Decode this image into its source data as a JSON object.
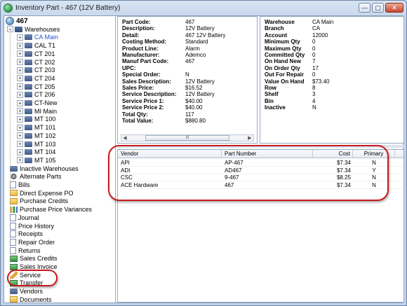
{
  "window": {
    "title": "Inventory Part - 467 (12V Battery)",
    "buttons": [
      "—",
      "▢",
      "✕"
    ]
  },
  "tree": {
    "root": "467",
    "warehouses_label": "Warehouses",
    "warehouses": [
      "CA Main",
      "CAL T1",
      "CT 201",
      "CT 202",
      "CT 203",
      "CT 204",
      "CT 205",
      "CT 206",
      "CT-New",
      "MI Main",
      "MT 100",
      "MT 101",
      "MT 102",
      "MT 103",
      "MT 104",
      "MT 105"
    ],
    "items": [
      "Inactive Warehouses",
      "Alternate Parts",
      "Bills",
      "Direct Expense PO",
      "Purchase Credits",
      "Purchase Price Variances",
      "Journal",
      "Price History",
      "Receipts",
      "Repair Order",
      "Returns",
      "Sales Credits",
      "Sales Invoice",
      "Service",
      "Transfer",
      "Vendors",
      "Documents"
    ]
  },
  "part_details": {
    "rows": [
      {
        "k": "Part Code:",
        "v": "467"
      },
      {
        "k": "Description:",
        "v": "12V Battery"
      },
      {
        "k": "Detail:",
        "v": "467 12V Battery"
      },
      {
        "k": "Costing Method:",
        "v": "Standard"
      },
      {
        "k": "Product Line:",
        "v": "Alarm"
      },
      {
        "k": "Manufacturer:",
        "v": "Ademco"
      },
      {
        "k": "Manuf Part Code:",
        "v": "467"
      },
      {
        "k": "UPC:",
        "v": ""
      },
      {
        "k": "Special Order:",
        "v": "N"
      },
      {
        "k": "Sales Description:",
        "v": "12V Battery"
      },
      {
        "k": "Sales Price:",
        "v": "$16.52"
      },
      {
        "k": "Service Description:",
        "v": "12V Battery"
      },
      {
        "k": "Service Price 1:",
        "v": "$40.00"
      },
      {
        "k": "Service Price 2:",
        "v": "$40.00"
      },
      {
        "k": "Total Qty:",
        "v": "117"
      },
      {
        "k": "Total Value:",
        "v": "$880.80"
      }
    ],
    "scroll_thumb": "III"
  },
  "warehouse_details": {
    "rows": [
      {
        "k": "Warehouse",
        "v": "CA Main"
      },
      {
        "k": "Branch",
        "v": "CA"
      },
      {
        "k": "Account",
        "v": "12000"
      },
      {
        "k": "Minimum Qty",
        "v": "0"
      },
      {
        "k": "Maximum Qty",
        "v": "0"
      },
      {
        "k": "Committed Qty",
        "v": "0"
      },
      {
        "k": "On Hand New",
        "v": "7"
      },
      {
        "k": "On Order Qty",
        "v": "17"
      },
      {
        "k": "Out For Repair",
        "v": "0"
      },
      {
        "k": "Value On Hand",
        "v": "$73.40"
      },
      {
        "k": "Row",
        "v": "8"
      },
      {
        "k": "Shelf",
        "v": "3"
      },
      {
        "k": "Bin",
        "v": "4"
      },
      {
        "k": "Inactive",
        "v": "N"
      }
    ]
  },
  "vendors": {
    "columns": [
      "Vendor",
      "Part Number",
      "Cost",
      "Primary"
    ],
    "rows": [
      {
        "vendor": "API",
        "part": "AP-467",
        "cost": "$7.34",
        "primary": "N"
      },
      {
        "vendor": "ADI",
        "part": "AD467",
        "cost": "$7.34",
        "primary": "Y"
      },
      {
        "vendor": "CSC",
        "part": "9-467",
        "cost": "$8.25",
        "primary": "N"
      },
      {
        "vendor": "ACE Hardware",
        "part": "467",
        "cost": "$7.34",
        "primary": "N"
      }
    ]
  },
  "colors": {
    "annotation": "#c8191e",
    "selected_text": "#2a56c6"
  }
}
